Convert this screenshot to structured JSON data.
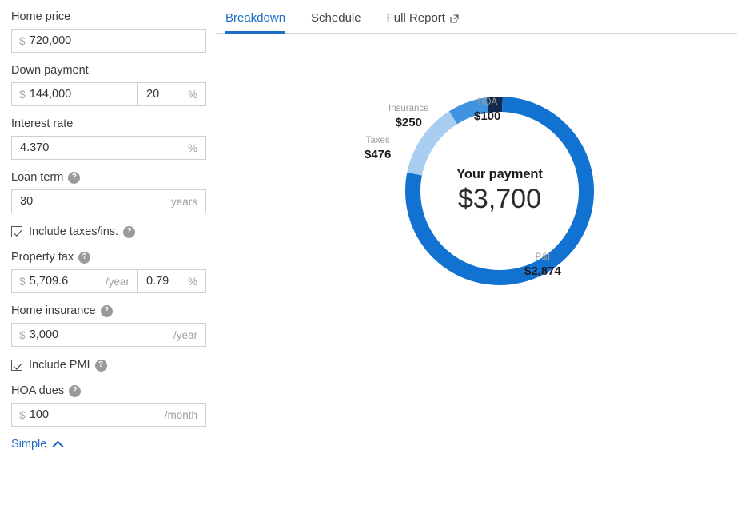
{
  "form": {
    "fields": [
      {
        "label": "Home price",
        "help": false,
        "prefix": "$",
        "value": "720,000",
        "suffix": "",
        "secondary": null
      },
      {
        "label": "Down payment",
        "help": false,
        "prefix": "$",
        "value": "144,000",
        "suffix": "",
        "secondary": {
          "value": "20",
          "suffix": "%"
        }
      },
      {
        "label": "Interest rate",
        "help": false,
        "prefix": "",
        "value": "4.370",
        "suffix": "%",
        "secondary": null
      },
      {
        "label": "Loan term",
        "help": true,
        "prefix": "",
        "value": "30",
        "suffix": "years",
        "secondary": null
      }
    ],
    "include_taxes": {
      "label": "Include taxes/ins.",
      "checked": true,
      "help": true
    },
    "fields2": [
      {
        "label": "Property tax",
        "help": true,
        "prefix": "$",
        "value": "5,709.6",
        "suffix": "/year",
        "secondary": {
          "value": "0.79",
          "suffix": "%"
        }
      },
      {
        "label": "Home insurance",
        "help": true,
        "prefix": "$",
        "value": "3,000",
        "suffix": "/year",
        "secondary": null
      }
    ],
    "include_pmi": {
      "label": "Include PMI",
      "checked": true,
      "help": true
    },
    "fields3": [
      {
        "label": "HOA dues",
        "help": true,
        "prefix": "$",
        "value": "100",
        "suffix": "/month",
        "secondary": null
      }
    ],
    "simple_toggle": {
      "label": "Simple",
      "icon": "chevron-up-icon"
    },
    "help_glyph": "?"
  },
  "tabs": [
    {
      "label": "Breakdown",
      "active": true,
      "icon": null
    },
    {
      "label": "Schedule",
      "active": false,
      "icon": null
    },
    {
      "label": "Full Report",
      "active": false,
      "icon": "external-link-icon"
    }
  ],
  "chart_data": {
    "type": "pie",
    "variant": "donut",
    "title": "Your payment",
    "center_label": "Your payment",
    "center_value": "$3,700",
    "total": 3700,
    "start_angle_deg": -8,
    "direction": "clockwise",
    "inner_radius_ratio": 0.845,
    "categories": [
      "HOA",
      "P&I",
      "Taxes",
      "Insurance"
    ],
    "values": [
      100,
      2874,
      476,
      250
    ],
    "value_labels": [
      "$100",
      "$2,874",
      "$476",
      "$250"
    ],
    "colors": [
      "#13294e",
      "#1272d1",
      "#a9cdf0",
      "#3f93e0"
    ],
    "slices": [
      {
        "name": "HOA",
        "value": 100,
        "label": "$100",
        "color": "#13294e",
        "percent": 2.7
      },
      {
        "name": "P&I",
        "value": 2874,
        "label": "$2,874",
        "color": "#1272d1",
        "percent": 77.7
      },
      {
        "name": "Taxes",
        "value": 476,
        "label": "$476",
        "color": "#a9cdf0",
        "percent": 12.9
      },
      {
        "name": "Insurance",
        "value": 250,
        "label": "$250",
        "color": "#3f93e0",
        "percent": 6.8
      }
    ],
    "legend": "callouts",
    "grid": false
  },
  "colors": {
    "accent": "#1b6ec2",
    "link": "#1f6bc4",
    "border": "#cfcfcf",
    "muted": "#9b9b9b"
  }
}
